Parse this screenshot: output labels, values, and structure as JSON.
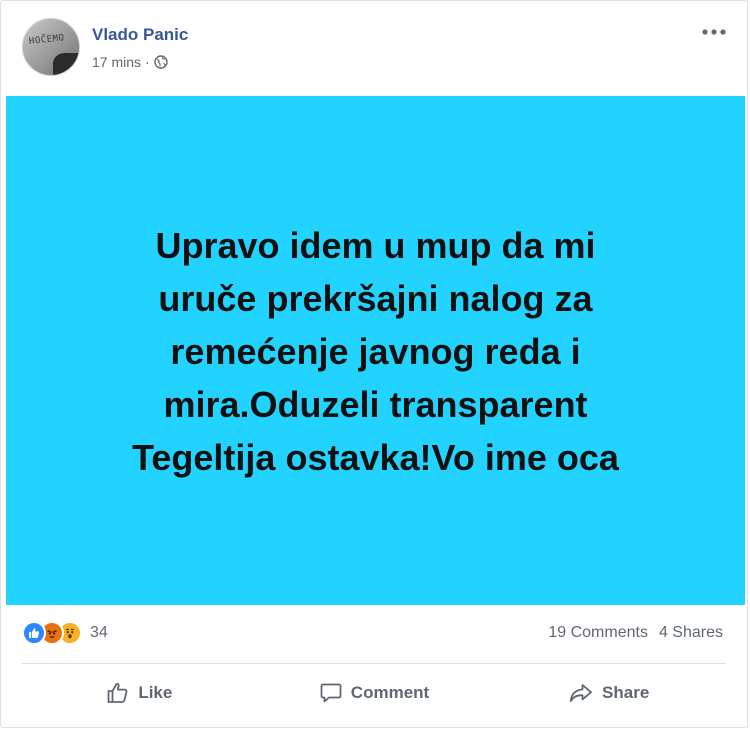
{
  "post": {
    "author": "Vlado Panic",
    "time": "17 mins",
    "separator": "·",
    "visibility_icon": "globe-icon",
    "more_icon": "more-options-icon",
    "avatar_text": "HOC̃EMO",
    "background_color": "#22d3ff",
    "lines": [
      "Upravo idem u mup da mi",
      "uruče prekršajni nalog za",
      "remećenje javnog reda i",
      "mira.Oduzeli transparent",
      "Tegeltija ostavka!Vo ime oca"
    ]
  },
  "stats": {
    "reactions": [
      "like-reaction-icon",
      "angry-reaction-icon",
      "wow-reaction-icon"
    ],
    "reaction_count": "34",
    "comments": "19 Comments",
    "shares": "4 Shares"
  },
  "actions": {
    "like": "Like",
    "comment": "Comment",
    "share": "Share"
  }
}
